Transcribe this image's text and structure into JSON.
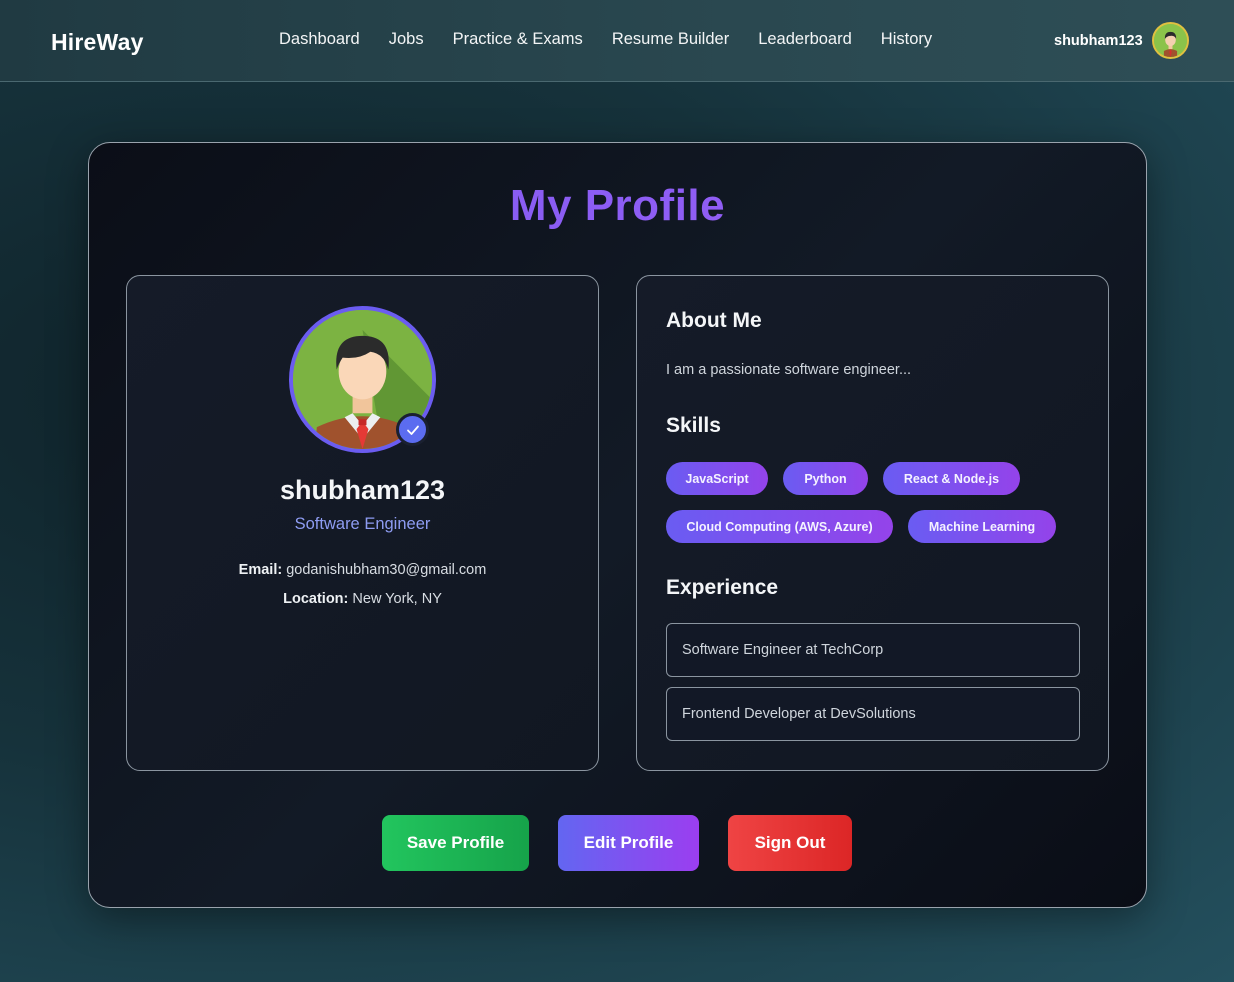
{
  "nav": {
    "brand": "HireWay",
    "links": [
      "Dashboard",
      "Jobs",
      "Practice & Exams",
      "Resume Builder",
      "Leaderboard",
      "History"
    ],
    "username": "shubham123",
    "avatar_icon": "user-avatar-icon"
  },
  "page": {
    "title": "My Profile"
  },
  "profile": {
    "name": "shubham123",
    "role": "Software Engineer",
    "email_label": "Email:",
    "email": "godanishubham30@gmail.com",
    "location_label": "Location:",
    "location": "New York, NY",
    "avatar_icon": "user-avatar-icon",
    "verified_icon": "check-icon"
  },
  "about": {
    "heading": "About Me",
    "text": "I am a passionate software engineer..."
  },
  "skills": {
    "heading": "Skills",
    "items": [
      "JavaScript",
      "Python",
      "React & Node.js",
      "Cloud Computing (AWS, Azure)",
      "Machine Learning"
    ]
  },
  "experience": {
    "heading": "Experience",
    "items": [
      "Software Engineer at TechCorp",
      "Frontend Developer at DevSolutions"
    ]
  },
  "actions": {
    "save": "Save Profile",
    "edit": "Edit Profile",
    "signout": "Sign Out"
  },
  "colors": {
    "accent": "#8b5cf6",
    "save": "#22c55e",
    "edit": "#6366f1",
    "signout": "#ef4444"
  }
}
